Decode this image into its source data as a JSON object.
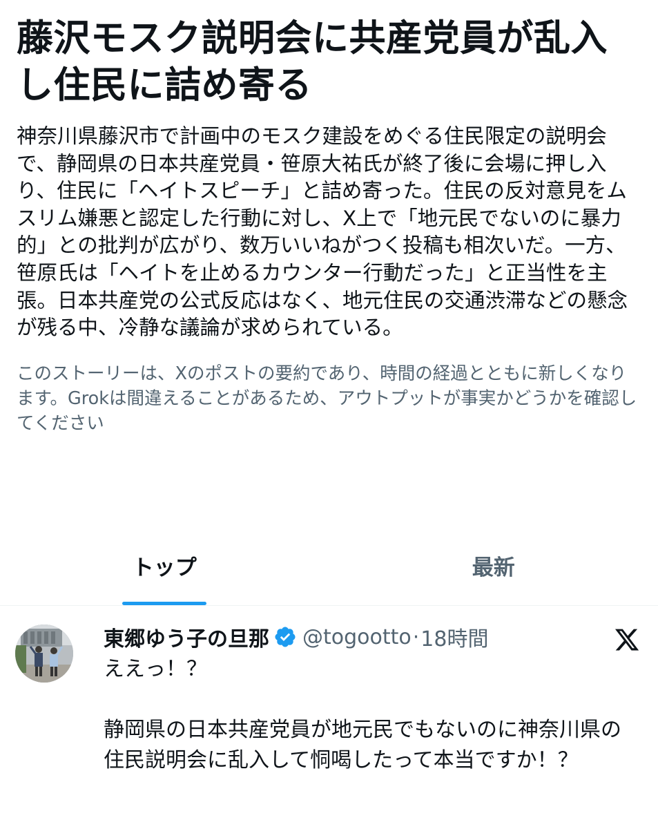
{
  "story": {
    "headline": "藤沢モスク説明会に共産党員が乱入し住民に詰め寄る",
    "summary": "神奈川県藤沢市で計画中のモスク建設をめぐる住民限定の説明会で、静岡県の日本共産党員・笹原大祐氏が終了後に会場に押し入り、住民に「ヘイトスピーチ」と詰め寄った。住民の反対意見をムスリム嫌悪と認定した行動に対し、X上で「地元民でないのに暴力的」との批判が広がり、数万いいねがつく投稿も相次いだ。一方、笹原氏は「ヘイトを止めるカウンター行動だった」と正当性を主張。日本共産党の公式反応はなく、地元住民の交通渋滞などの懸念が残る中、冷静な議論が求められている。",
    "disclaimer": "このストーリーは、Xのポストの要約であり、時間の経過とともに新しくなります。Grokは間違えることがあるため、アウトプットが事実かどうかを確認してください"
  },
  "tabs": [
    {
      "label": "トップ",
      "active": true
    },
    {
      "label": "最新",
      "active": false
    }
  ],
  "post": {
    "display_name": "東郷ゆう子の旦那",
    "verified_icon": "verified-badge-icon",
    "handle": "@togootto",
    "separator": "·",
    "time": "18時間",
    "platform_icon": "x-logo-icon",
    "body": "ええっ！？\n\n静岡県の日本共産党員が地元民でもないのに神奈川県の住民説明会に乱入して恫喝したって本当ですか！？"
  },
  "colors": {
    "text": "#0f1419",
    "secondary_text": "#536471",
    "accent": "#1d9bf0",
    "background": "#ffffff"
  }
}
